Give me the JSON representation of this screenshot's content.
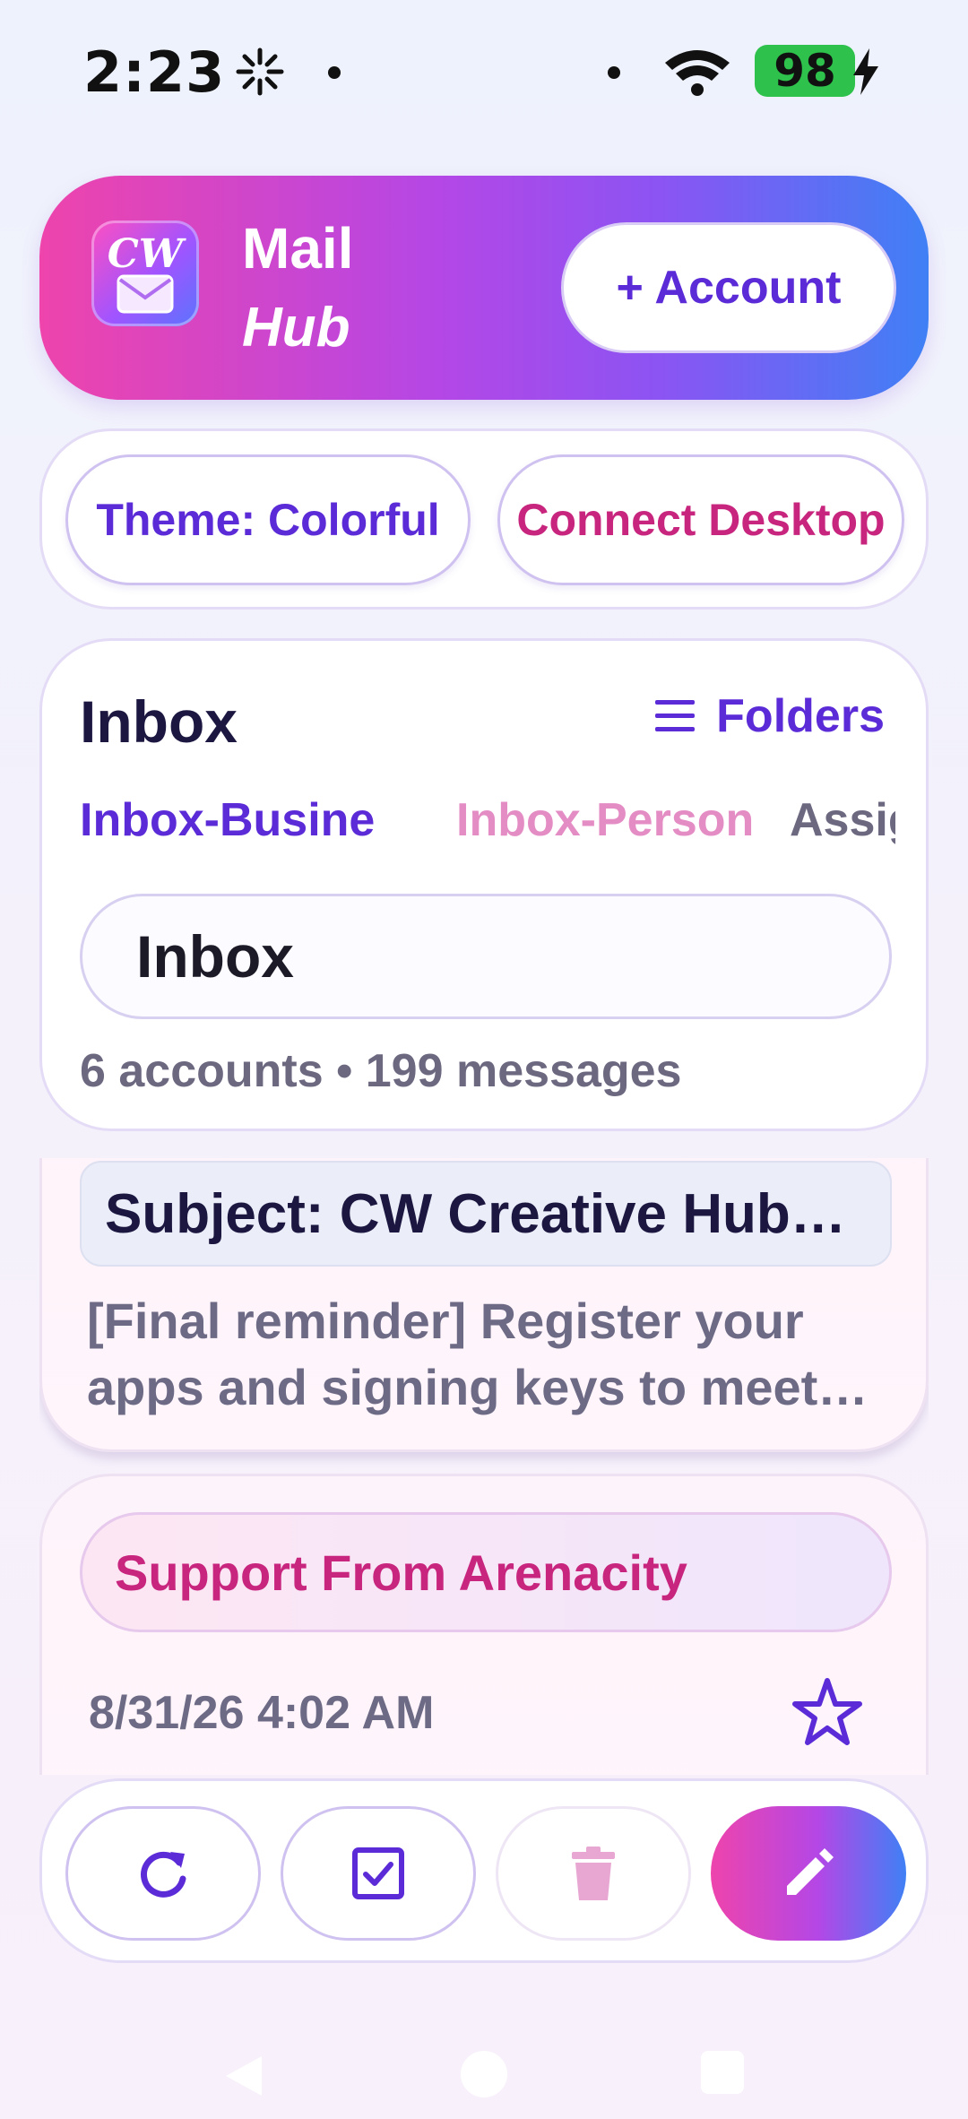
{
  "status_bar": {
    "time": "2:23",
    "battery": "98"
  },
  "header": {
    "logo_text": "CW",
    "title_line1": "Mail",
    "title_line2": "Hub",
    "add_account_label": "+ Account"
  },
  "toggles": {
    "theme_label": "Theme: Colorful",
    "connect_label": "Connect Desktop"
  },
  "inbox": {
    "title": "Inbox",
    "folders_label": "Folders",
    "tabs": [
      {
        "label": "Inbox-Busine"
      },
      {
        "label": "Inbox-Person"
      },
      {
        "label": "Assign"
      }
    ],
    "selected_folder": "Inbox",
    "summary": "6 accounts • 199 messages"
  },
  "messages": [
    {
      "subject": "Subject: CW Creative Hub…",
      "preview": "[Final reminder] Register your apps and signing keys to meet…"
    },
    {
      "sender": "Support From Arenacity",
      "date": "8/31/26 4:02 AM"
    }
  ],
  "colors": {
    "accent_purple": "#5b2bd8",
    "accent_pink": "#c8267e",
    "gradient_start": "#ee44ac",
    "gradient_end": "#3f80f5"
  },
  "icons": {
    "refresh": "refresh-icon",
    "select": "checkbox-icon",
    "delete": "trash-icon",
    "compose": "pencil-icon",
    "star": "star-outline-icon",
    "folders": "menu-icon"
  }
}
